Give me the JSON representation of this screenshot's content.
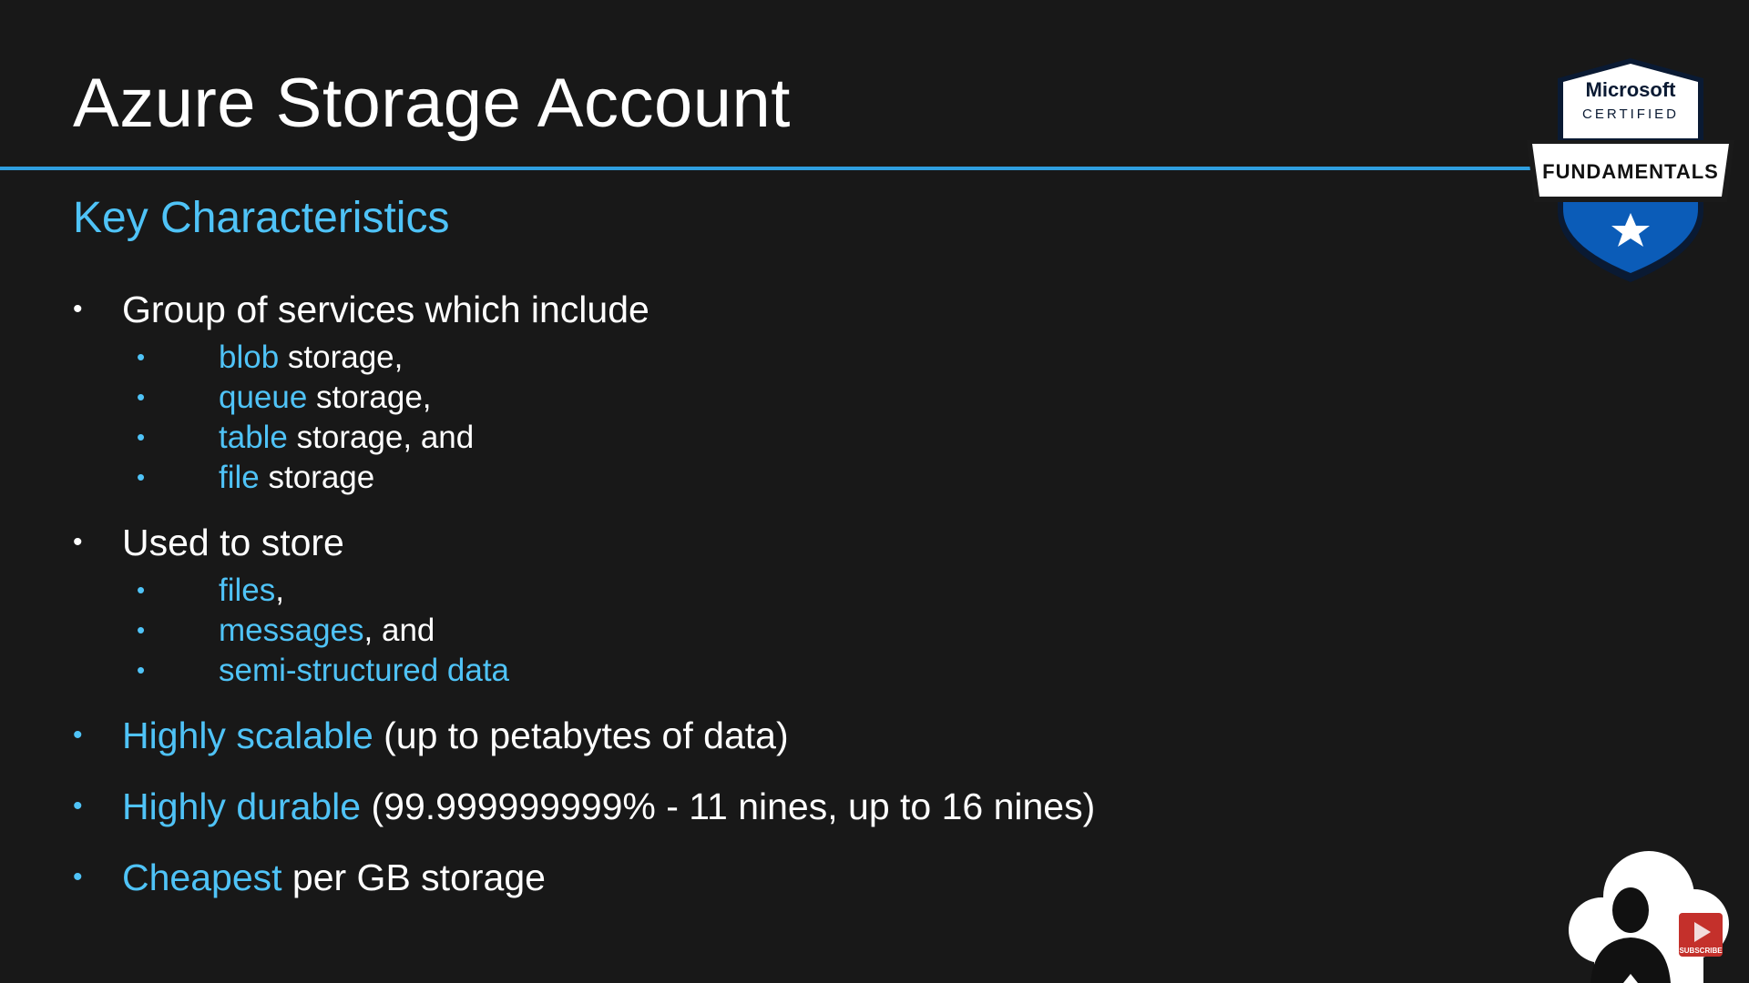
{
  "slide": {
    "title": "Azure Storage Account",
    "subtitle": "Key Characteristics"
  },
  "bullets": [
    {
      "highlight": "",
      "text": "Group of services which include",
      "sub": [
        {
          "highlight": "blob",
          "text": " storage,"
        },
        {
          "highlight": "queue",
          "text": " storage,"
        },
        {
          "highlight": "table",
          "text": " storage, and"
        },
        {
          "highlight": "file",
          "text": " storage"
        }
      ]
    },
    {
      "highlight": "",
      "text": "Used to store",
      "sub": [
        {
          "highlight": "files",
          "text": ","
        },
        {
          "highlight": "messages",
          "text": ", and"
        },
        {
          "highlight": "semi-structured data",
          "text": ""
        }
      ]
    },
    {
      "highlight": "Highly scalable",
      "text": " (up to petabytes of data)"
    },
    {
      "highlight": "Highly durable",
      "text": " (99.999999999% - 11 nines, up to 16 nines)"
    },
    {
      "highlight": "Cheapest",
      "text": " per GB storage"
    }
  ],
  "badge": {
    "line1": "Microsoft",
    "line2": "CERTIFIED",
    "banner": "FUNDAMENTALS"
  },
  "subscribe": {
    "label": "SUBSCRIBE"
  },
  "colors": {
    "background": "#181818",
    "accent": "#4fc3f7",
    "rule": "#2f9fe0",
    "badge_blue": "#0b5cb8",
    "subscribe_red": "#c4302b"
  }
}
